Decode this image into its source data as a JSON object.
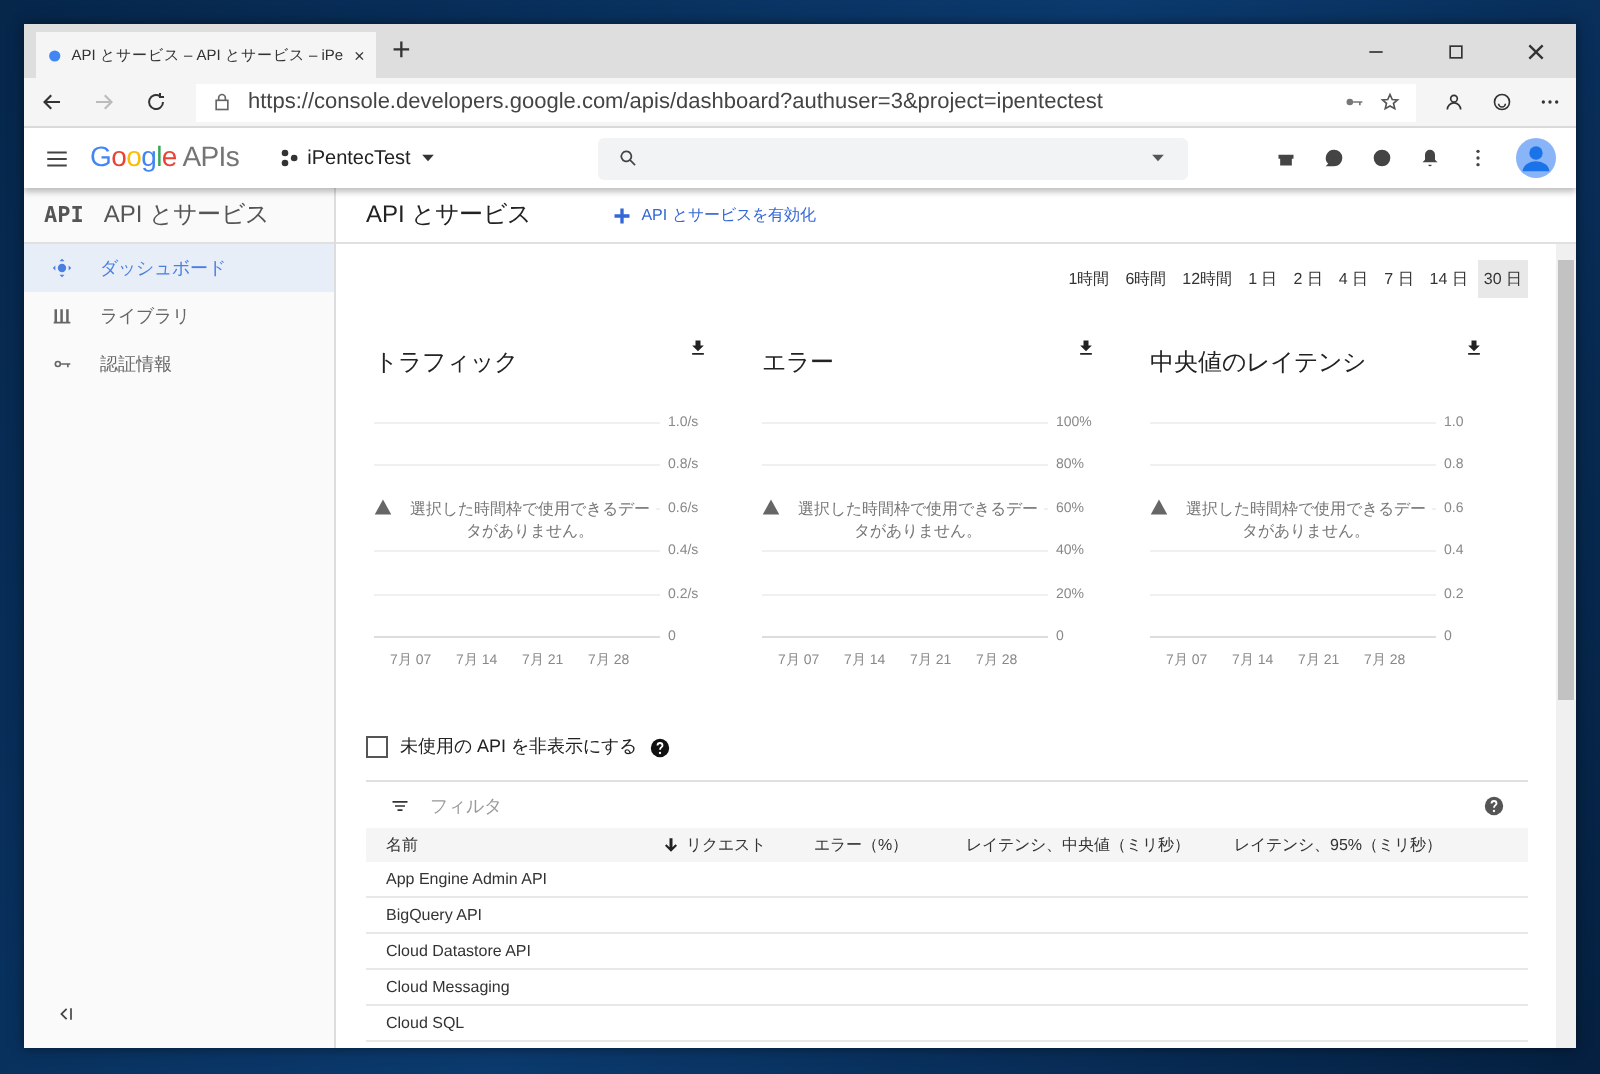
{
  "browser": {
    "tab_title": "API とサービス – API とサービス – iPe",
    "new_tab": "+",
    "url": "https://console.developers.google.com/apis/dashboard?authuser=3&project=ipentectest"
  },
  "header": {
    "brand": "Google",
    "product": "APIs",
    "project": "iPentecTest"
  },
  "sidebar": {
    "logo": "API",
    "title": "API とサービス",
    "items": [
      {
        "label": "ダッシュボード",
        "kind": "dashboard",
        "selected": true
      },
      {
        "label": "ライブラリ",
        "kind": "library",
        "selected": false
      },
      {
        "label": "認証情報",
        "kind": "credentials",
        "selected": false
      }
    ]
  },
  "page": {
    "title": "API とサービス",
    "enable_button": "API とサービスを有効化"
  },
  "time_ranges": [
    {
      "label": "1時間",
      "selected": false
    },
    {
      "label": "6時間",
      "selected": false
    },
    {
      "label": "12時間",
      "selected": false
    },
    {
      "label": "1 日",
      "selected": false
    },
    {
      "label": "2 日",
      "selected": false
    },
    {
      "label": "4 日",
      "selected": false
    },
    {
      "label": "7 日",
      "selected": false
    },
    {
      "label": "14 日",
      "selected": false
    },
    {
      "label": "30 日",
      "selected": true
    }
  ],
  "charts": [
    {
      "title": "トラフィック",
      "y_ticks": [
        "1.0/s",
        "0.8/s",
        "0.6/s",
        "0.4/s",
        "0.2/s",
        "0"
      ],
      "x_labels": [
        "7月 07",
        "7月 14",
        "7月 21",
        "7月 28"
      ],
      "message": "選択した時間枠で使用できるデータがありません。"
    },
    {
      "title": "エラー",
      "y_ticks": [
        "100%",
        "80%",
        "60%",
        "40%",
        "20%",
        "0"
      ],
      "x_labels": [
        "7月 07",
        "7月 14",
        "7月 21",
        "7月 28"
      ],
      "message": "選択した時間枠で使用できるデータがありません。"
    },
    {
      "title": "中央値のレイテンシ",
      "y_ticks": [
        "1.0",
        "0.8",
        "0.6",
        "0.4",
        "0.2",
        "0"
      ],
      "x_labels": [
        "7月 07",
        "7月 14",
        "7月 21",
        "7月 28"
      ],
      "message": "選択した時間枠で使用できるデータがありません。"
    }
  ],
  "hide_unused": {
    "label": "未使用の API を非表示にする",
    "checked": false
  },
  "filter": {
    "placeholder": "フィルタ"
  },
  "table": {
    "columns": [
      {
        "label": "名前",
        "sorted": false
      },
      {
        "label": "リクエスト",
        "sorted": true
      },
      {
        "label": "エラー（%）",
        "sorted": false
      },
      {
        "label": "レイテンシ、中央値（ミリ秒）",
        "sorted": false
      },
      {
        "label": "レイテンシ、95%（ミリ秒）",
        "sorted": false
      }
    ],
    "rows": [
      [
        "App Engine Admin API"
      ],
      [
        "BigQuery API"
      ],
      [
        "Cloud Datastore API"
      ],
      [
        "Cloud Messaging"
      ],
      [
        "Cloud SQL"
      ]
    ]
  }
}
